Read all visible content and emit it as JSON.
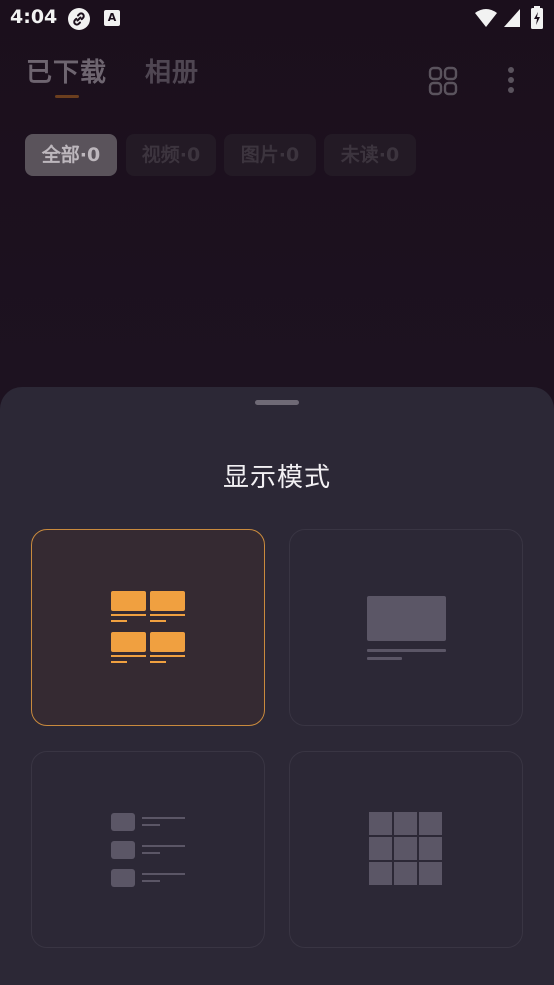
{
  "status_bar": {
    "time": "4:04",
    "icons": [
      "link-icon",
      "a-icon",
      "wifi-icon",
      "signal-icon",
      "battery-icon"
    ],
    "a_icon_letter": "A"
  },
  "header": {
    "tabs": [
      {
        "label": "已下载",
        "active": true
      },
      {
        "label": "相册",
        "active": false
      }
    ],
    "actions": [
      "grid-view-icon",
      "more-icon"
    ]
  },
  "filters": [
    {
      "label": "全部·0",
      "selected": true
    },
    {
      "label": "视频·0",
      "selected": false
    },
    {
      "label": "图片·0",
      "selected": false
    },
    {
      "label": "未读·0",
      "selected": false
    }
  ],
  "sheet": {
    "title": "显示模式",
    "modes": [
      {
        "name": "two-column-grid",
        "selected": true
      },
      {
        "name": "single-large",
        "selected": false
      },
      {
        "name": "list",
        "selected": false
      },
      {
        "name": "three-column-grid",
        "selected": false
      }
    ]
  },
  "colors": {
    "accent": "#f0a040",
    "accent_border": "#c98a3d",
    "sheet_bg": "#2c2836",
    "inactive_icon": "#5b5666"
  }
}
